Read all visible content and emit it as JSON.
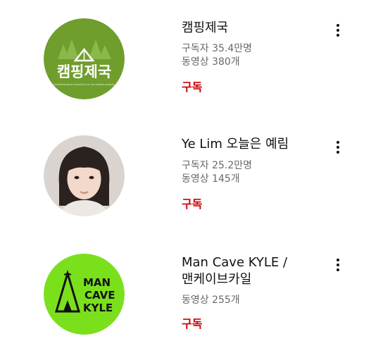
{
  "channels": [
    {
      "name": "캠핑제국",
      "stats": [
        "구독자 35.4만명",
        "동영상 380개"
      ],
      "subscribe_label": "구독",
      "avatar": {
        "text": "캠핑제국",
        "tagline": "Everything about camping & car and outdoor products",
        "bg": "#6f9e2c"
      },
      "more_icon": "more-vert-icon"
    },
    {
      "name": "Ye Lim 오늘은 예림",
      "stats": [
        "구독자 25.2만명",
        "동영상 145개"
      ],
      "subscribe_label": "구독",
      "avatar": {
        "bg": "#d9d4cf"
      },
      "more_icon": "more-vert-icon"
    },
    {
      "name": "Man Cave KYLE /",
      "name_line2": "맨케이브카일",
      "stats": [
        "동영상 255개"
      ],
      "subscribe_label": "구독",
      "avatar": {
        "text_lines": [
          "MAN",
          "CAVE",
          "KYLE"
        ],
        "bg": "#7be01c"
      },
      "more_icon": "more-vert-icon"
    }
  ],
  "colors": {
    "subscribe": "#cc0000",
    "meta": "#686868"
  }
}
